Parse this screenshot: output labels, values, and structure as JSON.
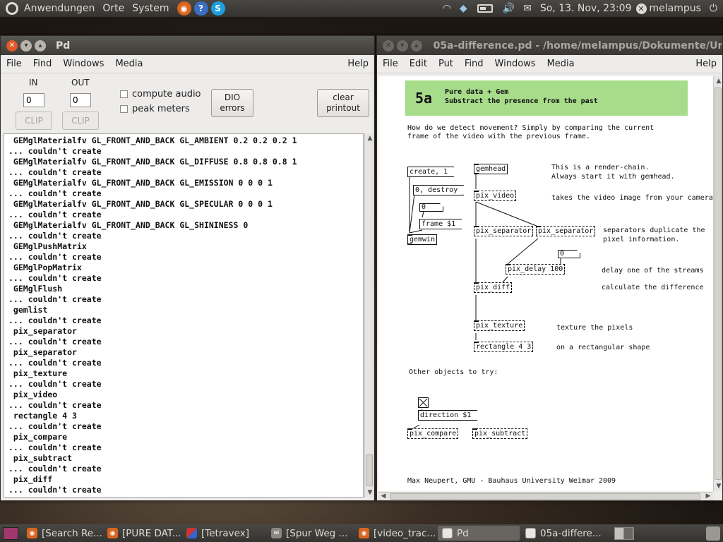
{
  "top_panel": {
    "menus": [
      "Anwendungen",
      "Orte",
      "System"
    ],
    "clock": "So, 13. Nov, 23:09",
    "user": "melampus"
  },
  "pd_window": {
    "title": "Pd",
    "menu": [
      "File",
      "Find",
      "Windows",
      "Media"
    ],
    "help": "Help",
    "in_label": "IN",
    "out_label": "OUT",
    "in_value": "0",
    "out_value": "0",
    "clip_label": "CLIP",
    "compute_audio": "compute audio",
    "peak_meters": "peak meters",
    "dio_errors_1": "DIO",
    "dio_errors_2": "errors",
    "clear_printout_1": "clear",
    "clear_printout_2": "printout",
    "console_lines": [
      " GEMglMaterialfv GL_FRONT_AND_BACK GL_AMBIENT 0.2 0.2 0.2 1",
      "... couldn't create",
      " GEMglMaterialfv GL_FRONT_AND_BACK GL_DIFFUSE 0.8 0.8 0.8 1",
      "... couldn't create",
      " GEMglMaterialfv GL_FRONT_AND_BACK GL_EMISSION 0 0 0 1",
      "... couldn't create",
      " GEMglMaterialfv GL_FRONT_AND_BACK GL_SPECULAR 0 0 0 1",
      "... couldn't create",
      " GEMglMaterialfv GL_FRONT_AND_BACK GL_SHININESS 0",
      "... couldn't create",
      " GEMglPushMatrix",
      "... couldn't create",
      " GEMglPopMatrix",
      "... couldn't create",
      " GEMglFlush",
      "... couldn't create",
      " gemlist",
      "... couldn't create",
      " pix_separator",
      "... couldn't create",
      " pix_separator",
      "... couldn't create",
      " pix_texture",
      "... couldn't create",
      " pix_video",
      "... couldn't create",
      " rectangle 4 3",
      "... couldn't create",
      " pix_compare",
      "... couldn't create",
      " pix_subtract",
      "... couldn't create",
      " pix_diff",
      "... couldn't create"
    ]
  },
  "patch_window": {
    "title": "05a-difference.pd  - /home/melampus/Dokumente/Un",
    "menu": [
      "File",
      "Edit",
      "Put",
      "Find",
      "Windows",
      "Media"
    ],
    "help": "Help",
    "header_num": "5a",
    "header_line1": "Pure data + Gem",
    "header_line2": "Substract the presence from the past",
    "intro_1": "How do we detect movement? Simply by comparing the current",
    "intro_2": "frame of the video with the previous frame.",
    "obj_create": "create, 1",
    "obj_destroy": "0, destroy",
    "num_a": "0",
    "obj_frame": "frame $1",
    "obj_gemwin": "gemwin",
    "obj_gemhead": "gemhead",
    "obj_pix_video": "pix_video",
    "obj_sep1": "pix_separator",
    "obj_sep2": "pix_separator",
    "num_b": "0",
    "obj_delay": "pix_delay 100",
    "obj_diff": "pix_diff",
    "obj_texture": "pix_texture",
    "obj_rect": "rectangle 4 3",
    "c_render1": "This is a render-chain.",
    "c_render2": "Always start it with gemhead.",
    "c_video": "takes the video image from your camera",
    "c_sep1": "separators duplicate the",
    "c_sep2": "pixel information.",
    "c_delay": "delay one of the streams",
    "c_diff": "calculate the difference",
    "c_texture": "texture the pixels",
    "c_rect": "on a rectangular shape",
    "c_other": "Other objects to try:",
    "obj_direction": "direction $1",
    "obj_compare": "pix_compare",
    "obj_subtract": "pix_subtract",
    "credit": "Max Neupert, GMU - Bauhaus University Weimar 2009"
  },
  "taskbar": {
    "tasks": [
      "[Search Re...",
      "[PURE DAT...",
      "[Tetravex]",
      "[Spur Weg ...",
      "[video_trac...",
      "Pd",
      "05a-differe..."
    ]
  },
  "colors": {
    "header_green": "#a7dc8b",
    "close_orange": "#e05a2a",
    "panel_dark": "#3e3c37"
  }
}
